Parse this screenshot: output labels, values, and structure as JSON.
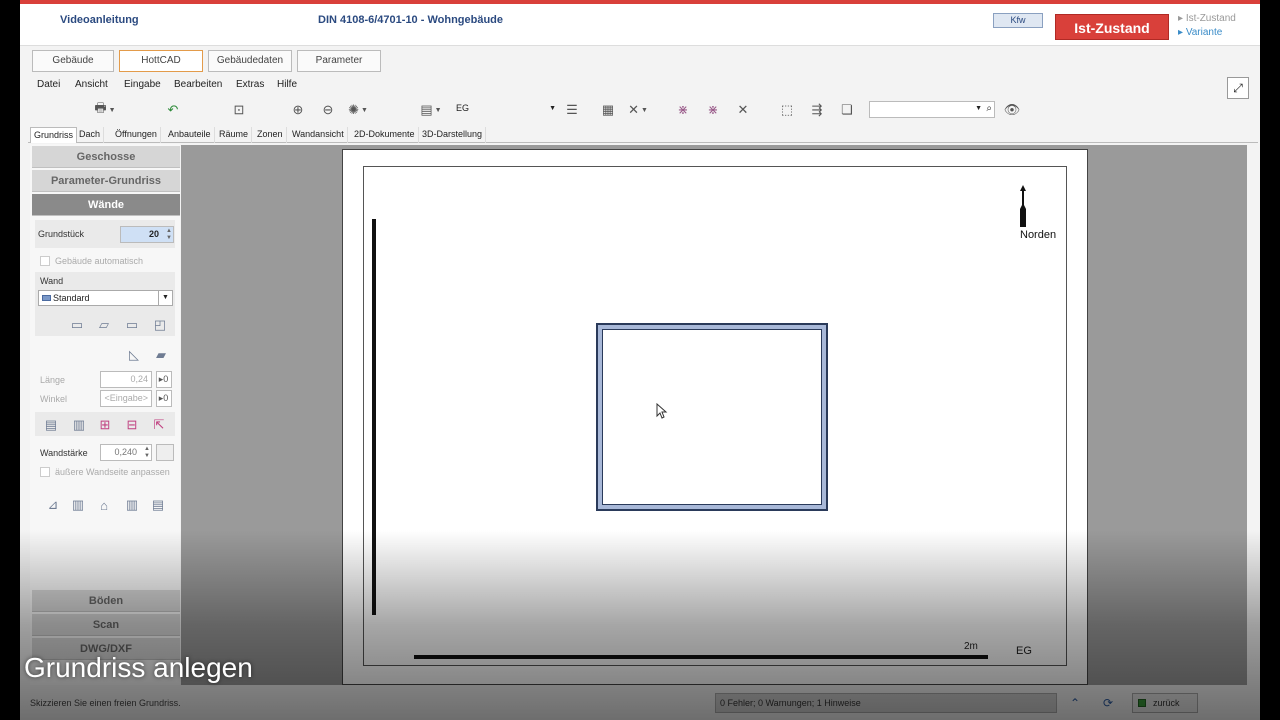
{
  "header": {
    "video_label": "Videoanleitung",
    "norm_label": "DIN 4108-6/4701-10  -  Wohngebäude",
    "kfw_label": "Kfw",
    "state_button": "Ist-Zustand",
    "links": [
      "Ist-Zustand",
      "Variante"
    ]
  },
  "main_tabs": [
    "Gebäude",
    "HottCAD",
    "Gebäudedaten",
    "Parameter"
  ],
  "menu": [
    "Datei",
    "Ansicht",
    "Eingabe",
    "Bearbeiten",
    "Extras",
    "Hilfe"
  ],
  "toolbar": {
    "floor_select": "EG",
    "search_value": ""
  },
  "view_tabs": [
    "Grundriss",
    "Dach",
    "Öffnungen",
    "Anbauteile",
    "Räume",
    "Zonen",
    "Wandansicht",
    "2D-Dokumente",
    "3D-Darstellung"
  ],
  "left_panel": {
    "sections_top": [
      "Geschosse",
      "Parameter-Grundriss",
      "Wände"
    ],
    "grundstueck_label": "Grundstück",
    "grundstueck_value": "20",
    "auto_building_label": "Gebäude automatisch",
    "wall_label": "Wand",
    "wall_value": "Standard",
    "length_label": "Länge",
    "length_value": "0,24",
    "angle_label": "Winkel",
    "angle_value": "<Eingabe>",
    "toggle_value": "0",
    "thickness_label": "Wandstärke",
    "thickness_value": "0,240",
    "adjust_label": "äußere Wandseite anpassen",
    "sections_bottom": [
      "Böden",
      "Scan",
      "DWG/DXF"
    ]
  },
  "canvas": {
    "north_label": "Norden",
    "scale_label": "2m",
    "floor_label": "EG"
  },
  "status": {
    "hint": "Skizzieren Sie einen freien Grundriss.",
    "messages": "0 Fehler; 0 Warnungen; 1 Hinweise",
    "back_label": "zurück"
  },
  "caption": "Grundriss anlegen",
  "colors": {
    "accent_red": "#d9403a",
    "active_section": "#8a8a8a",
    "wall_fill": "#a8b8d8"
  }
}
